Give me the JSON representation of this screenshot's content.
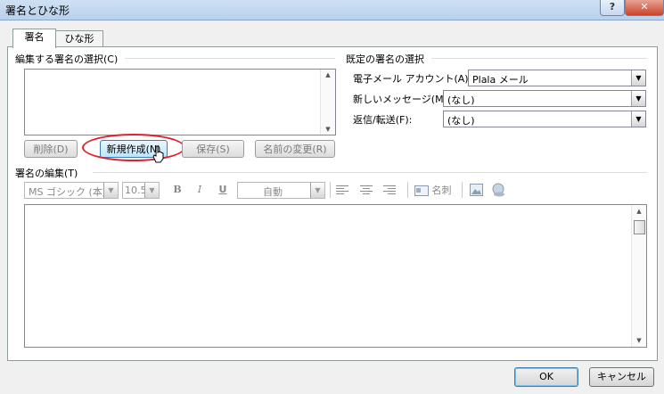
{
  "window": {
    "title": "署名とひな形",
    "help": "?",
    "close": "✕"
  },
  "tabs": [
    {
      "label": "署名"
    },
    {
      "label": "ひな形"
    }
  ],
  "select_section": {
    "heading": "編集する署名の選択(C)",
    "buttons": {
      "delete": "削除(D)",
      "new": "新規作成(N)",
      "save": "保存(S)",
      "rename": "名前の変更(R)"
    }
  },
  "default_section": {
    "heading": "既定の署名の選択",
    "account_label": "電子メール アカウント(A):",
    "account_value": "Plala メール",
    "new_label": "新しいメッセージ(M):",
    "new_value": "(なし)",
    "reply_label": "返信/転送(F):",
    "reply_value": "(なし)"
  },
  "edit_section": {
    "heading": "署名の編集(T)",
    "font": "MS ゴシック (本文",
    "size": "10.5",
    "bold": "B",
    "italic": "I",
    "underline": "U",
    "color": "自動",
    "business_card": "名刺"
  },
  "dialog_buttons": {
    "ok": "OK",
    "cancel": "キャンセル"
  }
}
